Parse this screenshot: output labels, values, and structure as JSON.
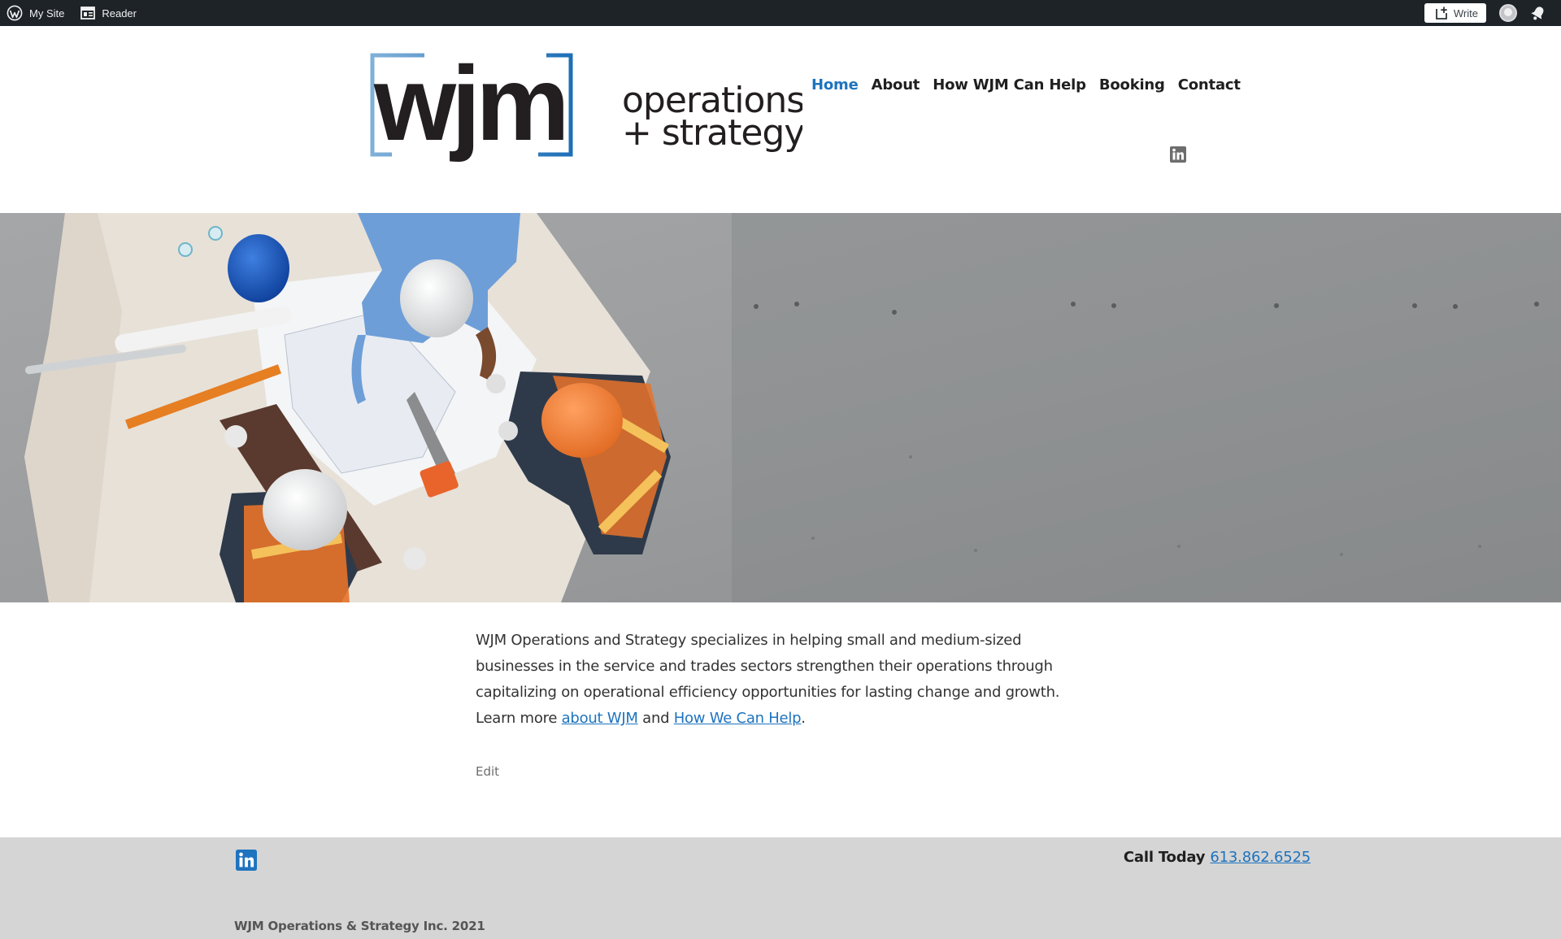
{
  "admin_bar": {
    "my_site_label": "My Site",
    "reader_label": "Reader",
    "write_label": "Write"
  },
  "header": {
    "logo": {
      "wordmark": "wjm",
      "line1": "operations",
      "line2": "+ strategy"
    },
    "nav": [
      {
        "label": "Home",
        "current": true
      },
      {
        "label": "About",
        "current": false
      },
      {
        "label": "How WJM Can Help",
        "current": false
      },
      {
        "label": "Booking",
        "current": false
      },
      {
        "label": "Contact",
        "current": false
      }
    ],
    "social_icon": "linkedin-icon"
  },
  "hero": {
    "image_subject": "overhead view of construction workers in hard hats planning over blueprints on a concrete floor"
  },
  "content": {
    "intro_text": "WJM Operations and Strategy specializes in helping small and medium-sized businesses in the service and trades sectors strengthen their operations through capitalizing on operational efficiency opportunities for lasting change and growth. Learn more ",
    "about_link": "about WJM",
    "and_text": " and ",
    "help_link": "How We Can Help",
    "end_text": ".",
    "edit_label": "Edit"
  },
  "footer": {
    "social_icon": "linkedin-icon",
    "call_label": "Call Today",
    "phone": "613.862.6525",
    "copyright": "WJM Operations & Strategy Inc. 2021"
  },
  "colors": {
    "admin_bar": "#1d2327",
    "accent": "#1e73be",
    "logo_dark": "#231f20",
    "footer_bg": "#d5d5d5"
  }
}
